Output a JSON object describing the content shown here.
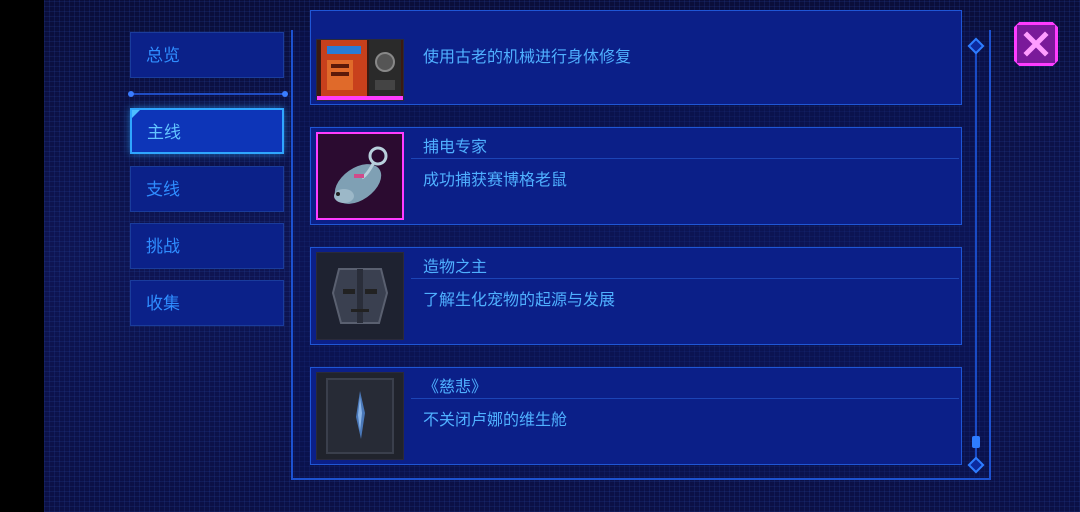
{
  "sidebar": {
    "overview": "总览",
    "tabs": [
      {
        "label": "主线",
        "active": true
      },
      {
        "label": "支线",
        "active": false
      },
      {
        "label": "挑战",
        "active": false
      },
      {
        "label": "收集",
        "active": false
      }
    ]
  },
  "achievements": [
    {
      "title": "",
      "desc": "使用古老的机械进行身体修复",
      "icon": "machine-icon"
    },
    {
      "title": "捕电专家",
      "desc": "成功捕获赛博格老鼠",
      "icon": "cyber-rat-icon"
    },
    {
      "title": "造物之主",
      "desc": "了解生化宠物的起源与发展",
      "icon": "android-face-icon"
    },
    {
      "title": "《慈悲》",
      "desc": "不关闭卢娜的维生舱",
      "icon": "life-pod-icon"
    }
  ],
  "colors": {
    "accent": "#2fa6ff",
    "text": "#4fb0ff",
    "close": "#ff3cff"
  }
}
